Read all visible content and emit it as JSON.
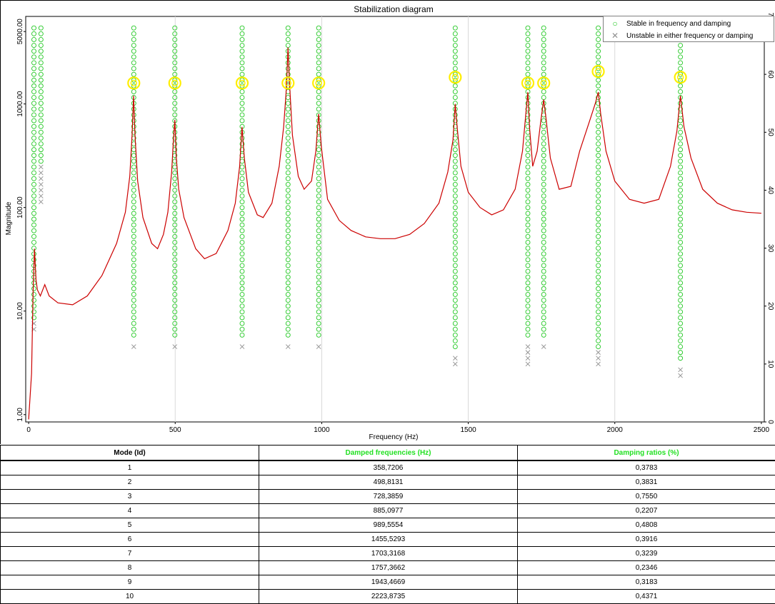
{
  "chart_data": {
    "type": "line",
    "title": "Stabilization diagram",
    "xlabel": "Frequency (Hz)",
    "ylabel": "Magnitude",
    "xlim": [
      -10,
      2510
    ],
    "ylim": [
      0.85,
      7000
    ],
    "y_scale": "log",
    "y2_lim": [
      0,
      70
    ],
    "x_ticks": [
      0,
      500,
      1000,
      1500,
      2000,
      2500
    ],
    "x_tick_labels": [
      "0",
      "500",
      "1000",
      "1500",
      "2000",
      "2500"
    ],
    "y_ticks": [
      1,
      10,
      100,
      1000,
      5000
    ],
    "y_tick_labels": [
      "1.00",
      "10.00",
      "100.00",
      "1000.00",
      "5000.00"
    ],
    "y2_ticks": [
      0,
      10,
      20,
      30,
      40,
      50,
      60,
      70
    ],
    "y2_tick_labels": [
      "0",
      "10",
      "20",
      "30",
      "40",
      "50",
      "60",
      "70"
    ],
    "grid": "x-only",
    "legend_position": "top-right",
    "legend": [
      {
        "label": "Stable in frequency and damping",
        "symbol": "circle",
        "color": "#22c822"
      },
      {
        "label": "Unstable in either frequency or damping",
        "symbol": "x",
        "color": "#909090"
      }
    ],
    "curve_color": "#cc0000",
    "frf_curve": {
      "x": [
        0,
        10,
        15,
        20,
        25,
        30,
        40,
        55,
        70,
        100,
        150,
        200,
        250,
        300,
        330,
        345,
        353,
        358,
        363,
        372,
        390,
        420,
        440,
        460,
        475,
        488,
        494,
        498.8,
        504,
        512,
        530,
        570,
        600,
        640,
        680,
        705,
        720,
        728,
        736,
        750,
        780,
        800,
        830,
        855,
        870,
        880,
        885,
        890,
        900,
        920,
        940,
        965,
        980,
        989.5,
        998,
        1020,
        1060,
        1100,
        1150,
        1200,
        1250,
        1300,
        1350,
        1400,
        1430,
        1448,
        1455.5,
        1462,
        1475,
        1500,
        1540,
        1580,
        1620,
        1660,
        1685,
        1698,
        1703.3,
        1709,
        1720,
        1735,
        1748,
        1757.4,
        1766,
        1780,
        1810,
        1850,
        1880,
        1915,
        1933,
        1943.5,
        1952,
        1970,
        2000,
        2050,
        2100,
        2150,
        2190,
        2212,
        2224,
        2236,
        2260,
        2300,
        2350,
        2400,
        2450,
        2500
      ],
      "y": [
        0.9,
        2.5,
        15,
        40,
        20,
        16,
        14,
        18,
        14,
        12,
        11.5,
        14,
        22,
        45,
        90,
        200,
        500,
        1200,
        500,
        180,
        80,
        45,
        40,
        55,
        90,
        220,
        450,
        700,
        300,
        150,
        80,
        40,
        32,
        36,
        60,
        110,
        250,
        600,
        300,
        140,
        85,
        80,
        110,
        250,
        600,
        1500,
        3500,
        1600,
        500,
        200,
        150,
        180,
        350,
        800,
        400,
        120,
        75,
        60,
        52,
        50,
        50,
        55,
        70,
        110,
        220,
        450,
        1000,
        600,
        250,
        140,
        100,
        85,
        95,
        150,
        350,
        900,
        1300,
        600,
        250,
        350,
        700,
        1100,
        700,
        300,
        150,
        160,
        350,
        700,
        1000,
        1300,
        800,
        350,
        180,
        120,
        110,
        120,
        250,
        550,
        1200,
        600,
        300,
        150,
        110,
        95,
        90,
        88
      ]
    },
    "identified_poles": {
      "x": [
        358.7206,
        498.8131,
        728.3859,
        885.0977,
        989.5554,
        1455.5293,
        1703.3168,
        1757.3662,
        1943.4669,
        2223.8735
      ],
      "model_order": [
        58.5,
        58.5,
        58.5,
        58.5,
        58.5,
        59.5,
        58.5,
        58.5,
        60.5,
        59.5
      ],
      "marker_color": "#ffee00"
    },
    "stabilization_columns": [
      {
        "x": 18,
        "stable_from": 18,
        "stable_to": 68,
        "unstable": [
          16,
          17
        ]
      },
      {
        "x": 42,
        "stable_from": 45,
        "stable_to": 68,
        "unstable": [
          38,
          39,
          40,
          41,
          42,
          43,
          44
        ]
      },
      {
        "x": 358.7,
        "stable_from": 15,
        "stable_to": 68,
        "unstable": [
          13
        ]
      },
      {
        "x": 498.8,
        "stable_from": 15,
        "stable_to": 68,
        "unstable": [
          13
        ]
      },
      {
        "x": 728.4,
        "stable_from": 15,
        "stable_to": 68,
        "unstable": [
          13
        ]
      },
      {
        "x": 885.1,
        "stable_from": 15,
        "stable_to": 68,
        "unstable": [
          13
        ]
      },
      {
        "x": 989.6,
        "stable_from": 15,
        "stable_to": 68,
        "unstable": [
          13
        ]
      },
      {
        "x": 1455.5,
        "stable_from": 13,
        "stable_to": 68,
        "unstable": [
          10,
          11
        ]
      },
      {
        "x": 1703.3,
        "stable_from": 15,
        "stable_to": 68,
        "unstable": [
          10,
          11,
          12,
          13
        ]
      },
      {
        "x": 1757.4,
        "stable_from": 15,
        "stable_to": 68,
        "unstable": [
          13
        ]
      },
      {
        "x": 1943.5,
        "stable_from": 13,
        "stable_to": 68,
        "unstable": [
          10,
          11,
          12
        ]
      },
      {
        "x": 2223.9,
        "stable_from": 11,
        "stable_to": 66,
        "unstable": [
          8,
          9
        ]
      }
    ]
  },
  "table": {
    "headers": [
      "Mode (Id)",
      "Damped frequencies (Hz)",
      "Damping ratios (%)"
    ],
    "header_color": "#22e022",
    "rows": [
      [
        "1",
        "358,7206",
        "0,3783"
      ],
      [
        "2",
        "498,8131",
        "0,3831"
      ],
      [
        "3",
        "728,3859",
        "0,7550"
      ],
      [
        "4",
        "885,0977",
        "0,2207"
      ],
      [
        "5",
        "989,5554",
        "0,4808"
      ],
      [
        "6",
        "1455,5293",
        "0,3916"
      ],
      [
        "7",
        "1703,3168",
        "0,3239"
      ],
      [
        "8",
        "1757,3662",
        "0,2346"
      ],
      [
        "9",
        "1943,4669",
        "0,3183"
      ],
      [
        "10",
        "2223,8735",
        "0,4371"
      ]
    ]
  }
}
